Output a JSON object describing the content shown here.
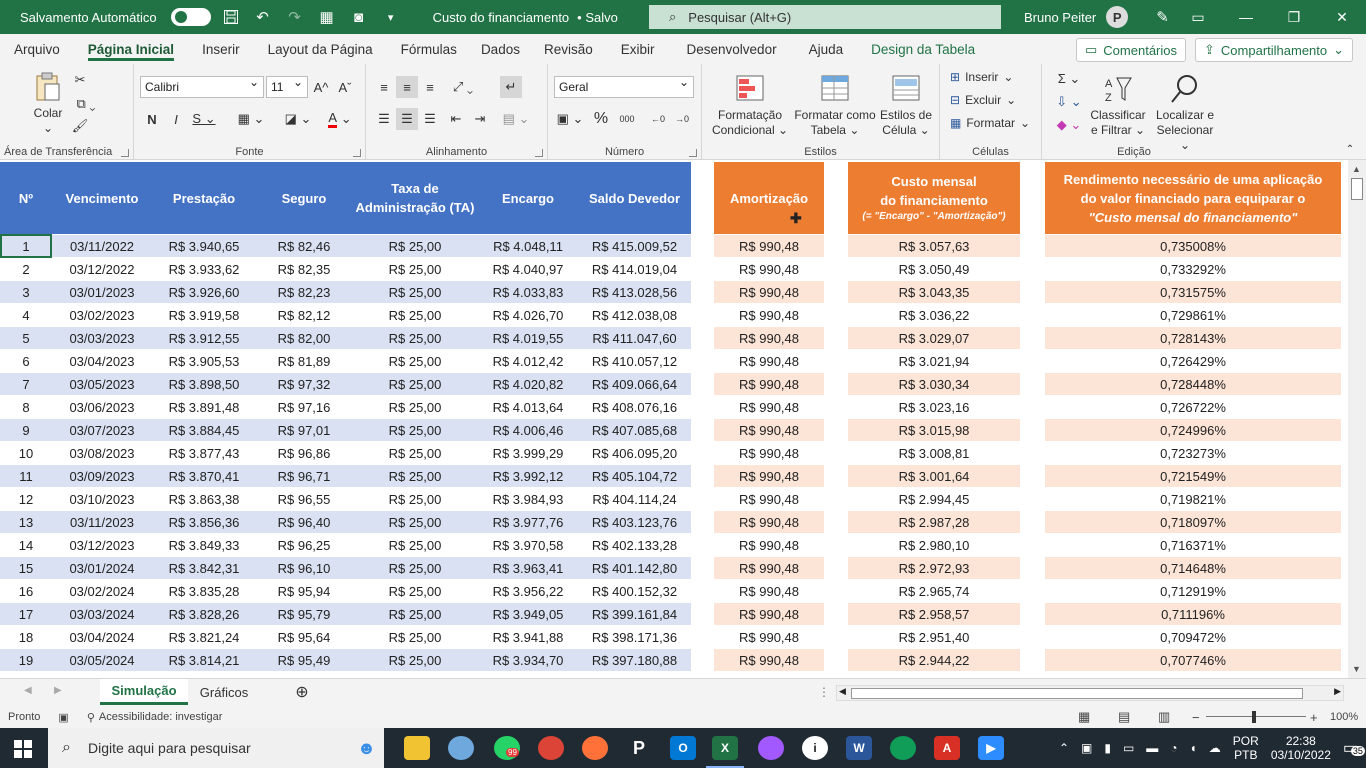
{
  "titlebar": {
    "autosave_label": "Salvamento Automático",
    "doc_title": "Custo do financiamento",
    "saved_status": "• Salvo",
    "search_placeholder": "Pesquisar (Alt+G)",
    "user_name": "Bruno Peiter",
    "avatar_initial": "P"
  },
  "menu": {
    "tabs": [
      "Arquivo",
      "Página Inicial",
      "Inserir",
      "Layout da Página",
      "Fórmulas",
      "Dados",
      "Revisão",
      "Exibir",
      "Desenvolvedor",
      "Ajuda",
      "Design da Tabela"
    ],
    "comments": "Comentários",
    "share": "Compartilhamento"
  },
  "ribbon": {
    "paste": "Colar",
    "clipboard_label": "Área de Transferência",
    "font_name": "Calibri",
    "font_size": "11",
    "font_label": "Fonte",
    "alignment_label": "Alinhamento",
    "number_format": "Geral",
    "number_label": "Número",
    "cond_format": [
      "Formatação",
      "Condicional"
    ],
    "format_table": [
      "Formatar como",
      "Tabela"
    ],
    "cell_styles": [
      "Estilos de",
      "Célula"
    ],
    "styles_label": "Estilos",
    "insert": "Inserir",
    "delete": "Excluir",
    "format": "Formatar",
    "cells_label": "Células",
    "sort_filter": [
      "Classificar",
      "e Filtrar"
    ],
    "find_select": [
      "Localizar e",
      "Selecionar"
    ],
    "editing_label": "Edição"
  },
  "headers": {
    "num": "Nº",
    "due": "Vencimento",
    "installment": "Prestação",
    "insurance": "Seguro",
    "admin_fee": [
      "Taxa de",
      "Administração (TA)"
    ],
    "charge": "Encargo",
    "balance": "Saldo Devedor",
    "amortization": "Amortização",
    "monthly_cost": [
      "Custo mensal",
      "do financiamento",
      "(= \"Encargo\" - \"Amortização\")"
    ],
    "yield_needed": [
      "Rendimento necessário de uma aplicação",
      "do valor financiado para equiparar o",
      "\"Custo mensal do financiamento\""
    ]
  },
  "rows": [
    {
      "n": "1",
      "due": "03/11/2022",
      "inst": "R$ 3.940,65",
      "ins": "R$ 82,46",
      "ta": "R$ 25,00",
      "chg": "R$ 4.048,11",
      "bal": "R$ 415.009,52",
      "am": "R$ 990,48",
      "cost": "R$ 3.057,63",
      "yld": "0,735008%"
    },
    {
      "n": "2",
      "due": "03/12/2022",
      "inst": "R$ 3.933,62",
      "ins": "R$ 82,35",
      "ta": "R$ 25,00",
      "chg": "R$ 4.040,97",
      "bal": "R$ 414.019,04",
      "am": "R$ 990,48",
      "cost": "R$ 3.050,49",
      "yld": "0,733292%"
    },
    {
      "n": "3",
      "due": "03/01/2023",
      "inst": "R$ 3.926,60",
      "ins": "R$ 82,23",
      "ta": "R$ 25,00",
      "chg": "R$ 4.033,83",
      "bal": "R$ 413.028,56",
      "am": "R$ 990,48",
      "cost": "R$ 3.043,35",
      "yld": "0,731575%"
    },
    {
      "n": "4",
      "due": "03/02/2023",
      "inst": "R$ 3.919,58",
      "ins": "R$ 82,12",
      "ta": "R$ 25,00",
      "chg": "R$ 4.026,70",
      "bal": "R$ 412.038,08",
      "am": "R$ 990,48",
      "cost": "R$ 3.036,22",
      "yld": "0,729861%"
    },
    {
      "n": "5",
      "due": "03/03/2023",
      "inst": "R$ 3.912,55",
      "ins": "R$ 82,00",
      "ta": "R$ 25,00",
      "chg": "R$ 4.019,55",
      "bal": "R$ 411.047,60",
      "am": "R$ 990,48",
      "cost": "R$ 3.029,07",
      "yld": "0,728143%"
    },
    {
      "n": "6",
      "due": "03/04/2023",
      "inst": "R$ 3.905,53",
      "ins": "R$ 81,89",
      "ta": "R$ 25,00",
      "chg": "R$ 4.012,42",
      "bal": "R$ 410.057,12",
      "am": "R$ 990,48",
      "cost": "R$ 3.021,94",
      "yld": "0,726429%"
    },
    {
      "n": "7",
      "due": "03/05/2023",
      "inst": "R$ 3.898,50",
      "ins": "R$ 97,32",
      "ta": "R$ 25,00",
      "chg": "R$ 4.020,82",
      "bal": "R$ 409.066,64",
      "am": "R$ 990,48",
      "cost": "R$ 3.030,34",
      "yld": "0,728448%"
    },
    {
      "n": "8",
      "due": "03/06/2023",
      "inst": "R$ 3.891,48",
      "ins": "R$ 97,16",
      "ta": "R$ 25,00",
      "chg": "R$ 4.013,64",
      "bal": "R$ 408.076,16",
      "am": "R$ 990,48",
      "cost": "R$ 3.023,16",
      "yld": "0,726722%"
    },
    {
      "n": "9",
      "due": "03/07/2023",
      "inst": "R$ 3.884,45",
      "ins": "R$ 97,01",
      "ta": "R$ 25,00",
      "chg": "R$ 4.006,46",
      "bal": "R$ 407.085,68",
      "am": "R$ 990,48",
      "cost": "R$ 3.015,98",
      "yld": "0,724996%"
    },
    {
      "n": "10",
      "due": "03/08/2023",
      "inst": "R$ 3.877,43",
      "ins": "R$ 96,86",
      "ta": "R$ 25,00",
      "chg": "R$ 3.999,29",
      "bal": "R$ 406.095,20",
      "am": "R$ 990,48",
      "cost": "R$ 3.008,81",
      "yld": "0,723273%"
    },
    {
      "n": "11",
      "due": "03/09/2023",
      "inst": "R$ 3.870,41",
      "ins": "R$ 96,71",
      "ta": "R$ 25,00",
      "chg": "R$ 3.992,12",
      "bal": "R$ 405.104,72",
      "am": "R$ 990,48",
      "cost": "R$ 3.001,64",
      "yld": "0,721549%"
    },
    {
      "n": "12",
      "due": "03/10/2023",
      "inst": "R$ 3.863,38",
      "ins": "R$ 96,55",
      "ta": "R$ 25,00",
      "chg": "R$ 3.984,93",
      "bal": "R$ 404.114,24",
      "am": "R$ 990,48",
      "cost": "R$ 2.994,45",
      "yld": "0,719821%"
    },
    {
      "n": "13",
      "due": "03/11/2023",
      "inst": "R$ 3.856,36",
      "ins": "R$ 96,40",
      "ta": "R$ 25,00",
      "chg": "R$ 3.977,76",
      "bal": "R$ 403.123,76",
      "am": "R$ 990,48",
      "cost": "R$ 2.987,28",
      "yld": "0,718097%"
    },
    {
      "n": "14",
      "due": "03/12/2023",
      "inst": "R$ 3.849,33",
      "ins": "R$ 96,25",
      "ta": "R$ 25,00",
      "chg": "R$ 3.970,58",
      "bal": "R$ 402.133,28",
      "am": "R$ 990,48",
      "cost": "R$ 2.980,10",
      "yld": "0,716371%"
    },
    {
      "n": "15",
      "due": "03/01/2024",
      "inst": "R$ 3.842,31",
      "ins": "R$ 96,10",
      "ta": "R$ 25,00",
      "chg": "R$ 3.963,41",
      "bal": "R$ 401.142,80",
      "am": "R$ 990,48",
      "cost": "R$ 2.972,93",
      "yld": "0,714648%"
    },
    {
      "n": "16",
      "due": "03/02/2024",
      "inst": "R$ 3.835,28",
      "ins": "R$ 95,94",
      "ta": "R$ 25,00",
      "chg": "R$ 3.956,22",
      "bal": "R$ 400.152,32",
      "am": "R$ 990,48",
      "cost": "R$ 2.965,74",
      "yld": "0,712919%"
    },
    {
      "n": "17",
      "due": "03/03/2024",
      "inst": "R$ 3.828,26",
      "ins": "R$ 95,79",
      "ta": "R$ 25,00",
      "chg": "R$ 3.949,05",
      "bal": "R$ 399.161,84",
      "am": "R$ 990,48",
      "cost": "R$ 2.958,57",
      "yld": "0,711196%"
    },
    {
      "n": "18",
      "due": "03/04/2024",
      "inst": "R$ 3.821,24",
      "ins": "R$ 95,64",
      "ta": "R$ 25,00",
      "chg": "R$ 3.941,88",
      "bal": "R$ 398.171,36",
      "am": "R$ 990,48",
      "cost": "R$ 2.951,40",
      "yld": "0,709472%"
    },
    {
      "n": "19",
      "due": "03/05/2024",
      "inst": "R$ 3.814,21",
      "ins": "R$ 95,49",
      "ta": "R$ 25,00",
      "chg": "R$ 3.934,70",
      "bal": "R$ 397.180,88",
      "am": "R$ 990,48",
      "cost": "R$ 2.944,22",
      "yld": "0,707746%"
    }
  ],
  "sheets": [
    "Simulação",
    "Gráficos"
  ],
  "status": {
    "ready": "Pronto",
    "accessibility": "Acessibilidade: investigar",
    "zoom": "100%"
  },
  "taskbar": {
    "search_placeholder": "Digite aqui para pesquisar",
    "lang": [
      "POR",
      "PTB"
    ],
    "time": "22:38",
    "date": "03/10/2022",
    "notif_count": "35",
    "whatsapp_badge": "99"
  },
  "colors": {
    "excel_green": "#217346",
    "header_blue": "#4472c4",
    "band_blue": "#d9e1f2",
    "header_orange": "#ed7d31",
    "band_orange": "#fce4d6",
    "band_orange_strong": "#f8cbad"
  }
}
